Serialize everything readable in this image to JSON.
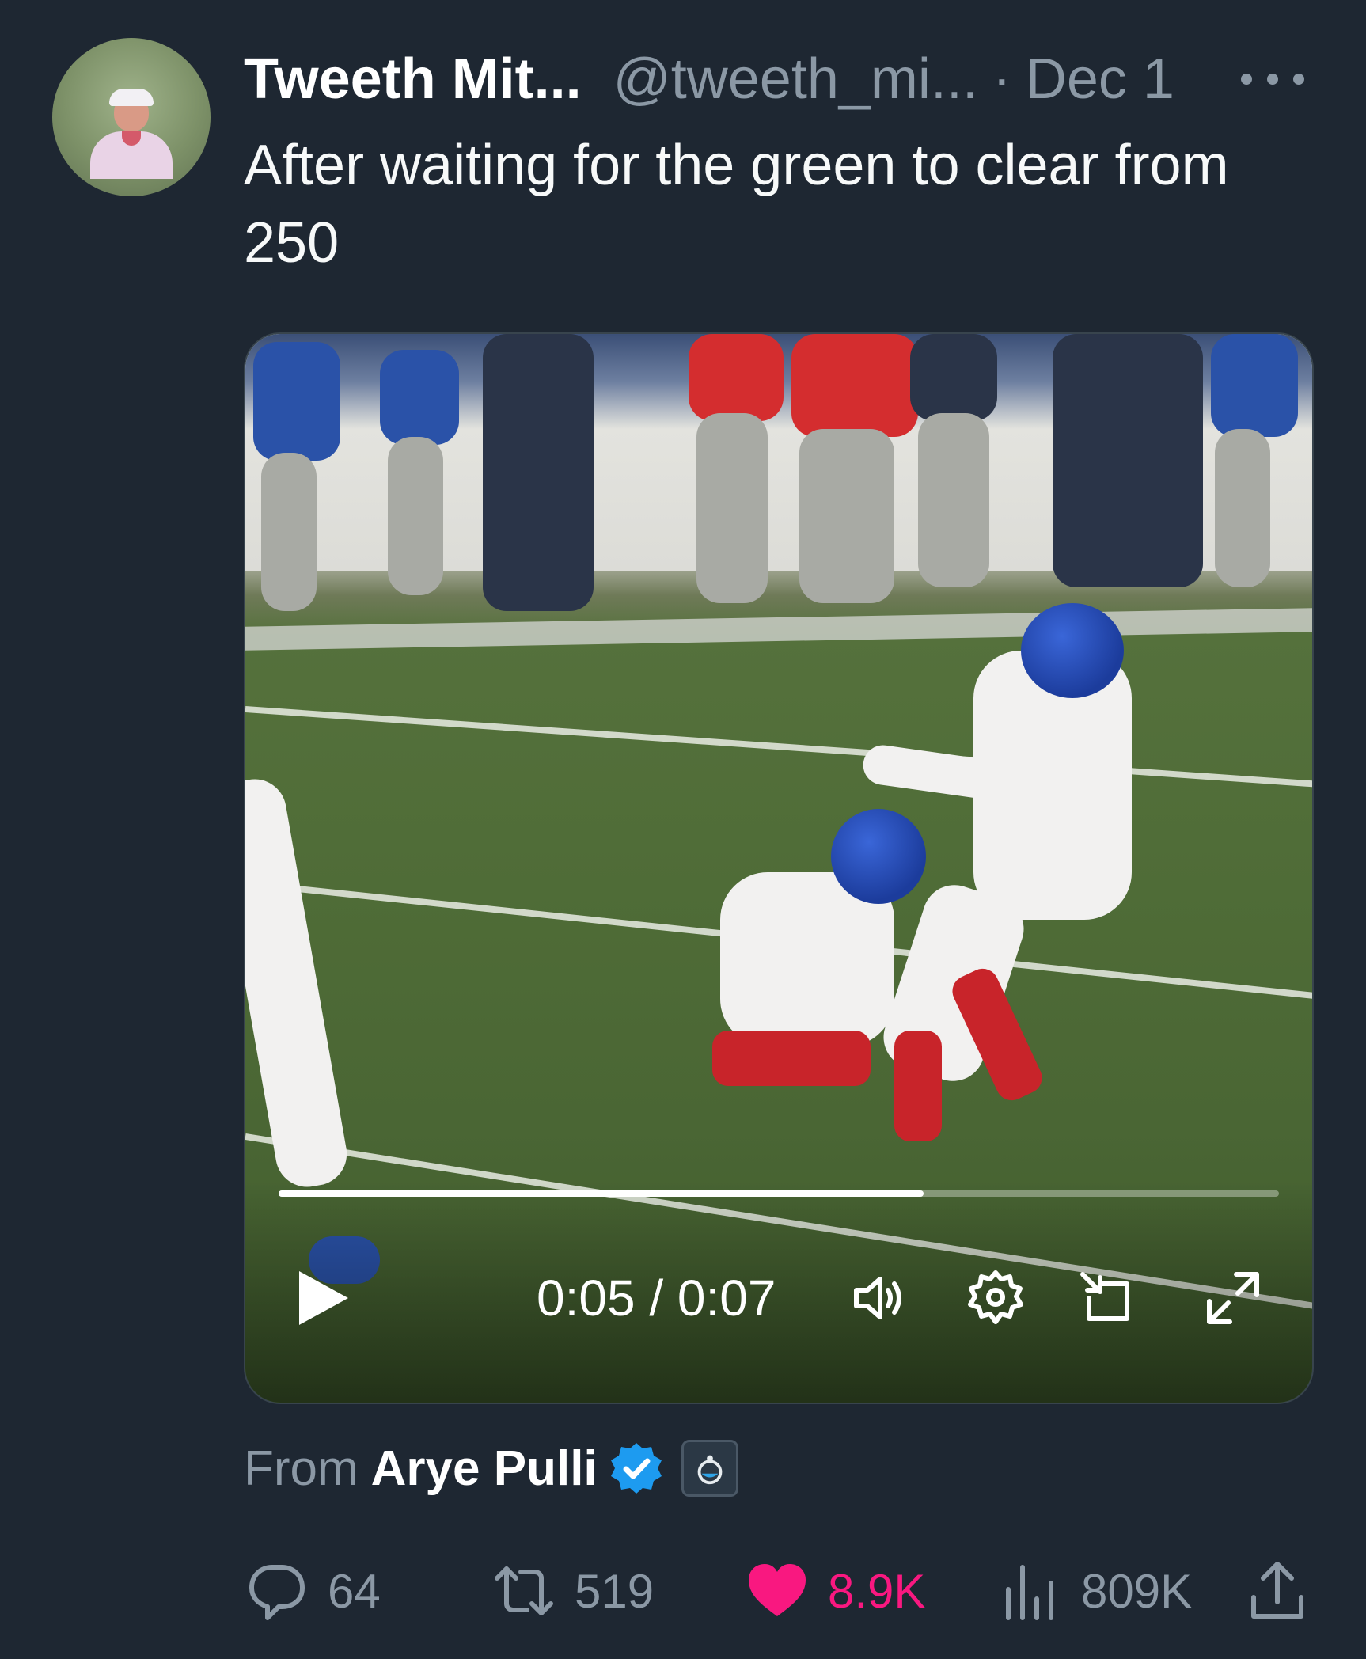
{
  "tweet": {
    "author_name": "Tweeth Mit...",
    "handle": "@tweeth_mi...",
    "separator": "·",
    "date": "Dec 1",
    "text": "After waiting for the green to clear from 250"
  },
  "video": {
    "current_time": "0:05",
    "time_separator": "/",
    "duration": "0:07",
    "progress_fraction": 0.645
  },
  "source": {
    "from_label": "From",
    "name": "Arye Pulli"
  },
  "actions": {
    "replies": "64",
    "reposts": "519",
    "likes": "8.9K",
    "views": "809K"
  },
  "colors": {
    "background": "#1e2732",
    "secondary_text": "#8b98a5",
    "like_pink": "#f91880",
    "verified_blue": "#1d9bf0"
  },
  "icons": {
    "more": "more-horizontal-icon",
    "play": "play-icon",
    "volume": "volume-icon",
    "settings": "gear-icon",
    "pip": "picture-in-picture-icon",
    "fullscreen": "fullscreen-icon",
    "verified": "verified-badge-icon",
    "affiliate": "affiliate-badge-icon",
    "reply": "reply-icon",
    "repost": "repost-icon",
    "like": "heart-icon",
    "views": "views-icon",
    "share": "share-icon"
  }
}
